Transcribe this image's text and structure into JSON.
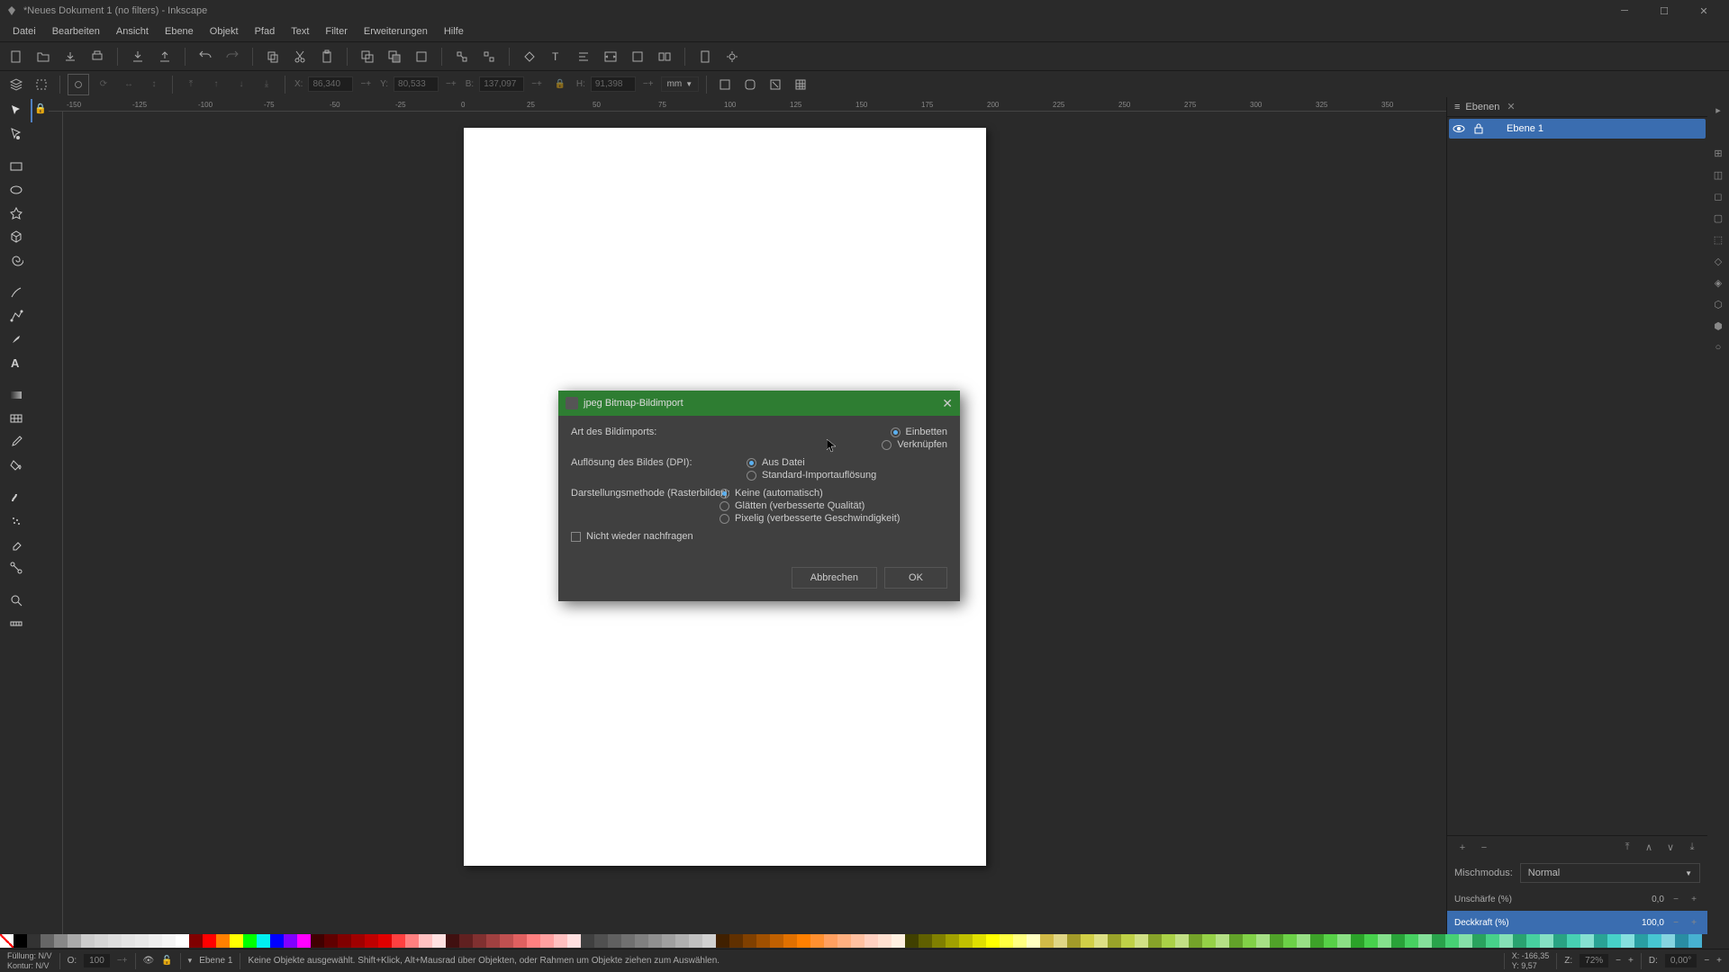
{
  "window": {
    "title": "*Neues Dokument 1 (no filters) - Inkscape"
  },
  "menu": {
    "items": [
      "Datei",
      "Bearbeiten",
      "Ansicht",
      "Ebene",
      "Objekt",
      "Pfad",
      "Text",
      "Filter",
      "Erweiterungen",
      "Hilfe"
    ]
  },
  "toolOptions": {
    "x_label": "X:",
    "x_value": "86,340",
    "y_label": "Y:",
    "y_value": "80,533",
    "w_label": "B:",
    "w_value": "137,097",
    "h_label": "H:",
    "h_value": "91,398",
    "unit": "mm"
  },
  "ruler": {
    "ticks": [
      "-150",
      "-125",
      "-100",
      "-75",
      "-50",
      "-25",
      "0",
      "25",
      "50",
      "75",
      "100",
      "125",
      "150",
      "175",
      "200",
      "225",
      "250",
      "275",
      "300",
      "325",
      "350"
    ]
  },
  "layersPanel": {
    "tab": "Ebenen",
    "layer1": "Ebene 1",
    "blendLabel": "Mischmodus:",
    "blendValue": "Normal",
    "blurLabel": "Unschärfe (%)",
    "blurValue": "0,0",
    "opacityLabel": "Deckkraft (%)",
    "opacityValue": "100,0"
  },
  "dialog": {
    "title": "jpeg Bitmap-Bildimport",
    "importTypeLabel": "Art des Bildimports:",
    "embed": "Einbetten",
    "link": "Verknüpfen",
    "dpiLabel": "Auflösung des Bildes (DPI):",
    "fromFile": "Aus Datei",
    "defaultRes": "Standard-Importauflösung",
    "renderLabel": "Darstellungsmethode (Rasterbilder):",
    "renderNone": "Keine (automatisch)",
    "renderSmooth": "Glätten (verbesserte Qualität)",
    "renderPixel": "Pixelig (verbesserte Geschwindigkeit)",
    "dontAsk": "Nicht wieder nachfragen",
    "cancel": "Abbrechen",
    "ok": "OK"
  },
  "status": {
    "fillLabel": "Füllung:",
    "fillValue": "N/V",
    "strokeLabel": "Kontur:",
    "strokeValue": "N/V",
    "opacityLabel": "O:",
    "opacityValue": "100",
    "layer": "Ebene 1",
    "hint": "Keine Objekte ausgewählt. Shift+Klick, Alt+Mausrad über Objekten, oder Rahmen um Objekte ziehen zum Auswählen.",
    "coordX_label": "X:",
    "coordX": "-166,35",
    "coordY_label": "Y:",
    "coordY": "9,57",
    "zoom_label": "Z:",
    "zoom": "72%",
    "rot_label": "D:",
    "rot": "0,00°"
  }
}
